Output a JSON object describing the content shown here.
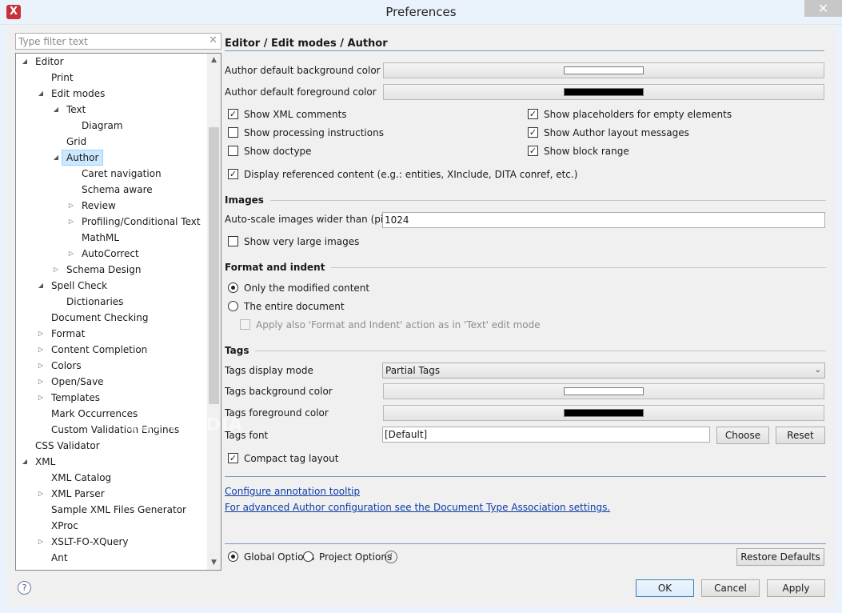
{
  "window": {
    "title": "Preferences",
    "app_icon": "X",
    "close_glyph": "✕"
  },
  "filter": {
    "placeholder": "Type filter text"
  },
  "tree": [
    {
      "label": "Editor",
      "depth": 0,
      "arrow": "open"
    },
    {
      "label": "Print",
      "depth": 1,
      "arrow": "none"
    },
    {
      "label": "Edit modes",
      "depth": 1,
      "arrow": "open"
    },
    {
      "label": "Text",
      "depth": 2,
      "arrow": "open"
    },
    {
      "label": "Diagram",
      "depth": 3,
      "arrow": "none"
    },
    {
      "label": "Grid",
      "depth": 2,
      "arrow": "none"
    },
    {
      "label": "Author",
      "depth": 2,
      "arrow": "open",
      "selected": true
    },
    {
      "label": "Caret navigation",
      "depth": 3,
      "arrow": "none"
    },
    {
      "label": "Schema aware",
      "depth": 3,
      "arrow": "none"
    },
    {
      "label": "Review",
      "depth": 3,
      "arrow": "closed"
    },
    {
      "label": "Profiling/Conditional Text",
      "depth": 3,
      "arrow": "closed"
    },
    {
      "label": "MathML",
      "depth": 3,
      "arrow": "none"
    },
    {
      "label": "AutoCorrect",
      "depth": 3,
      "arrow": "closed"
    },
    {
      "label": "Schema Design",
      "depth": 2,
      "arrow": "closed"
    },
    {
      "label": "Spell Check",
      "depth": 1,
      "arrow": "open"
    },
    {
      "label": "Dictionaries",
      "depth": 2,
      "arrow": "none"
    },
    {
      "label": "Document Checking",
      "depth": 1,
      "arrow": "none"
    },
    {
      "label": "Format",
      "depth": 1,
      "arrow": "closed"
    },
    {
      "label": "Content Completion",
      "depth": 1,
      "arrow": "closed"
    },
    {
      "label": "Colors",
      "depth": 1,
      "arrow": "closed"
    },
    {
      "label": "Open/Save",
      "depth": 1,
      "arrow": "closed"
    },
    {
      "label": "Templates",
      "depth": 1,
      "arrow": "closed"
    },
    {
      "label": "Mark Occurrences",
      "depth": 1,
      "arrow": "none"
    },
    {
      "label": "Custom Validation Engines",
      "depth": 1,
      "arrow": "none"
    },
    {
      "label": "CSS Validator",
      "depth": 0,
      "arrow": "none"
    },
    {
      "label": "XML",
      "depth": 0,
      "arrow": "open"
    },
    {
      "label": "XML Catalog",
      "depth": 1,
      "arrow": "none"
    },
    {
      "label": "XML Parser",
      "depth": 1,
      "arrow": "closed"
    },
    {
      "label": "Sample XML Files Generator",
      "depth": 1,
      "arrow": "none"
    },
    {
      "label": "XProc",
      "depth": 1,
      "arrow": "none"
    },
    {
      "label": "XSLT-FO-XQuery",
      "depth": 1,
      "arrow": "closed"
    },
    {
      "label": "Ant",
      "depth": 1,
      "arrow": "none"
    }
  ],
  "content": {
    "title": "Editor / Edit modes / Author",
    "bg_color_label": "Author default background color",
    "bg_color_value": "#ffffff",
    "fg_color_label": "Author default foreground color",
    "fg_color_value": "#000000",
    "checks": [
      {
        "label": "Show XML comments",
        "checked": true
      },
      {
        "label": "Show processing instructions",
        "checked": false
      },
      {
        "label": "Show doctype",
        "checked": false
      },
      {
        "label": "Display referenced content (e.g.: entities, XInclude, DITA conref, etc.)",
        "checked": true
      },
      {
        "label": "Show placeholders for empty elements",
        "checked": true
      },
      {
        "label": "Show Author layout messages",
        "checked": true
      },
      {
        "label": "Show block range",
        "checked": true
      }
    ],
    "images": {
      "section": "Images",
      "autoscale_label": "Auto-scale images wider than (pixels):",
      "autoscale_value": "1024",
      "large_images_label": "Show very large images",
      "large_images_checked": false
    },
    "format": {
      "section": "Format and indent",
      "opt_modified": "Only the modified content",
      "opt_entire": "The entire document",
      "selected": "modified",
      "apply_also": "Apply also 'Format and Indent' action as in 'Text' edit mode",
      "apply_also_checked": false,
      "apply_also_enabled": false
    },
    "tags": {
      "section": "Tags",
      "display_mode_label": "Tags display mode",
      "display_mode_value": "Partial Tags",
      "bg_label": "Tags background color",
      "bg_value": "#ffffff",
      "fg_label": "Tags foreground color",
      "fg_value": "#000000",
      "font_label": "Tags font",
      "font_value": "[Default]",
      "choose": "Choose",
      "reset": "Reset",
      "compact_label": "Compact tag layout",
      "compact_checked": true
    },
    "link_tooltip": "Configure annotation tooltip",
    "link_advanced": "For advanced Author configuration see the Document Type Association settings.",
    "scope": {
      "global": "Global Options",
      "project": "Project Options",
      "selected": "global",
      "info_glyph": "i"
    },
    "restore_defaults": "Restore Defaults"
  },
  "dialog_buttons": {
    "ok": "OK",
    "cancel": "Cancel",
    "apply": "Apply"
  },
  "help_glyph": "?",
  "watermark": "SOFTPEDIA"
}
